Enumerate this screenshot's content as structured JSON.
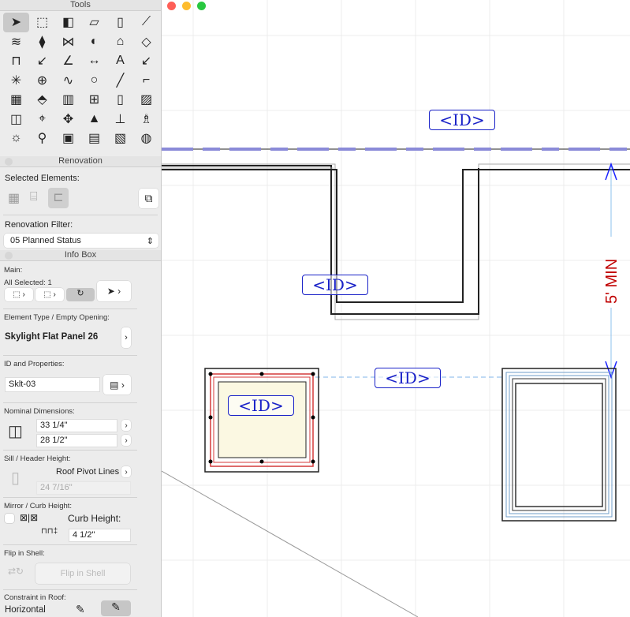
{
  "window": {
    "traffic_lights": {
      "close": "#fe5f57",
      "minimize": "#febc2e",
      "zoom": "#28c840"
    }
  },
  "tools_panel": {
    "title": "Tools",
    "selected_tool_index": 0
  },
  "renovation": {
    "title": "Renovation",
    "selected_elements_label": "Selected Elements:",
    "filter_label": "Renovation Filter:",
    "filter_value": "05 Planned Status"
  },
  "info_box": {
    "title": "Info Box",
    "main_label": "Main:",
    "all_selected": "All Selected: 1",
    "element_type_label": "Element Type / Empty Opening:",
    "element_type_value": "Skylight Flat Panel 26",
    "id_label": "ID and Properties:",
    "id_value": "Sklt-03",
    "nominal_label": "Nominal Dimensions:",
    "width_value": "33 1/4\"",
    "height_value": "28 1/2\"",
    "sill_label": "Sill / Header Height:",
    "sill_mode": "Roof Pivot Lines",
    "sill_value": "24 7/16\"",
    "mirror_label": "Mirror / Curb Height:",
    "curb_label": "Curb Height:",
    "curb_value": "4 1/2\"",
    "flip_label": "Flip in Shell:",
    "flip_button": "Flip in Shell",
    "constraint_label": "Constraint in Roof:",
    "constraint_value": "Horizontal"
  },
  "drawing": {
    "id_tags": [
      "<ID>",
      "<ID>",
      "<ID>",
      "<ID>"
    ],
    "dimension_text": "5' MIN",
    "colors": {
      "id_tag": "#1a22c8",
      "dimension_text": "#c00000",
      "dimension_line": "#1a22ff",
      "reference_dashed": "#8a8ad8",
      "grid": "#ececec",
      "skylight_fill": "#fbf8e2",
      "skylight_selected": "#d43a3a"
    }
  }
}
